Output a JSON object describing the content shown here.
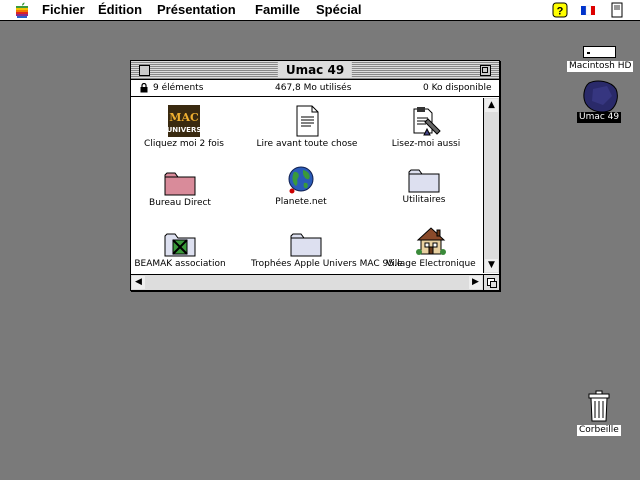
{
  "menubar": {
    "items": [
      "Fichier",
      "Édition",
      "Présentation",
      "Famille",
      "Spécial"
    ]
  },
  "desktop": {
    "disks": [
      {
        "label": "Macintosh HD",
        "icon": "hard-disk-icon"
      },
      {
        "label": "Umac 49",
        "icon": "removable-disk-icon",
        "selected": true
      }
    ],
    "trash_label": "Corbeille"
  },
  "window": {
    "title": "Umac 49",
    "items_count": "9 éléments",
    "used": "467,8 Mo utilisés",
    "available": "0  Ko disponible",
    "items": [
      {
        "label": "Cliquez moi 2 fois",
        "icon": "mac-univers-app-icon"
      },
      {
        "label": "Lire avant toute chose",
        "icon": "text-document-icon"
      },
      {
        "label": "Lisez-moi aussi",
        "icon": "readme-document-icon"
      },
      {
        "label": "Bureau Direct",
        "icon": "pink-folder-icon"
      },
      {
        "label": "Planete.net",
        "icon": "globe-icon"
      },
      {
        "label": "Utilitaires",
        "icon": "folder-icon"
      },
      {
        "label": "BEAMAK association",
        "icon": "beamak-folder-icon"
      },
      {
        "label": "Trophées Apple Univers MAC 95.e",
        "icon": "folder-icon"
      },
      {
        "label": "Village Electronique",
        "icon": "house-icon"
      }
    ]
  }
}
